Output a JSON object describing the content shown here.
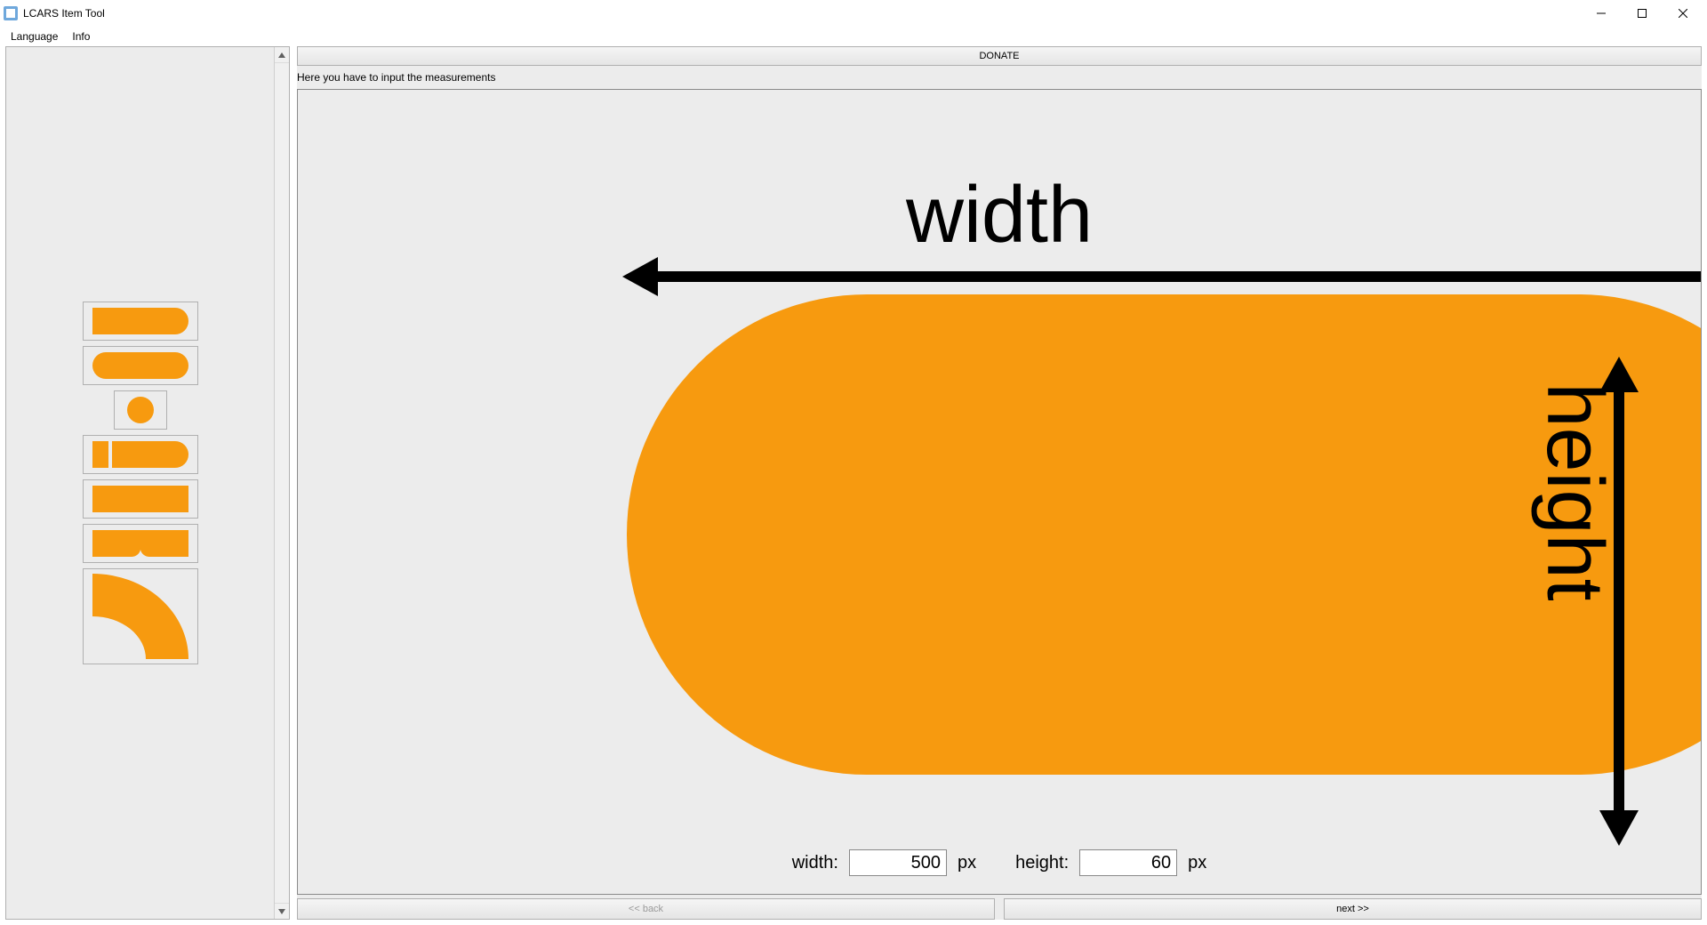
{
  "window": {
    "title": "LCARS Item Tool"
  },
  "menu": {
    "language": "Language",
    "info": "Info"
  },
  "sidebar": {
    "shapes": [
      "half-pill",
      "pill",
      "circle",
      "slider-pill",
      "rectangle",
      "tabbed-rect",
      "elbow"
    ]
  },
  "main": {
    "donate": "DONATE",
    "instruction": "Here you have to input the measurements",
    "width_label_big": "width",
    "height_label_big": "height",
    "input_width_label": "width:",
    "input_height_label": "height:",
    "input_width_value": "500",
    "input_height_value": "60",
    "unit": "px"
  },
  "nav": {
    "back": "<< back",
    "next": "next >>"
  },
  "colors": {
    "accent": "#f79a0f"
  }
}
